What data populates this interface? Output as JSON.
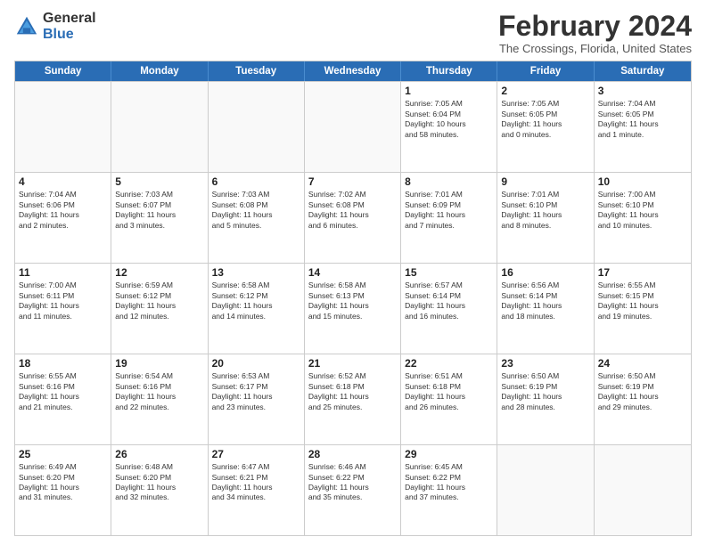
{
  "logo": {
    "general": "General",
    "blue": "Blue"
  },
  "header": {
    "title": "February 2024",
    "subtitle": "The Crossings, Florida, United States"
  },
  "weekdays": [
    "Sunday",
    "Monday",
    "Tuesday",
    "Wednesday",
    "Thursday",
    "Friday",
    "Saturday"
  ],
  "rows": [
    [
      {
        "day": "",
        "info": ""
      },
      {
        "day": "",
        "info": ""
      },
      {
        "day": "",
        "info": ""
      },
      {
        "day": "",
        "info": ""
      },
      {
        "day": "1",
        "info": "Sunrise: 7:05 AM\nSunset: 6:04 PM\nDaylight: 10 hours\nand 58 minutes."
      },
      {
        "day": "2",
        "info": "Sunrise: 7:05 AM\nSunset: 6:05 PM\nDaylight: 11 hours\nand 0 minutes."
      },
      {
        "day": "3",
        "info": "Sunrise: 7:04 AM\nSunset: 6:05 PM\nDaylight: 11 hours\nand 1 minute."
      }
    ],
    [
      {
        "day": "4",
        "info": "Sunrise: 7:04 AM\nSunset: 6:06 PM\nDaylight: 11 hours\nand 2 minutes."
      },
      {
        "day": "5",
        "info": "Sunrise: 7:03 AM\nSunset: 6:07 PM\nDaylight: 11 hours\nand 3 minutes."
      },
      {
        "day": "6",
        "info": "Sunrise: 7:03 AM\nSunset: 6:08 PM\nDaylight: 11 hours\nand 5 minutes."
      },
      {
        "day": "7",
        "info": "Sunrise: 7:02 AM\nSunset: 6:08 PM\nDaylight: 11 hours\nand 6 minutes."
      },
      {
        "day": "8",
        "info": "Sunrise: 7:01 AM\nSunset: 6:09 PM\nDaylight: 11 hours\nand 7 minutes."
      },
      {
        "day": "9",
        "info": "Sunrise: 7:01 AM\nSunset: 6:10 PM\nDaylight: 11 hours\nand 8 minutes."
      },
      {
        "day": "10",
        "info": "Sunrise: 7:00 AM\nSunset: 6:10 PM\nDaylight: 11 hours\nand 10 minutes."
      }
    ],
    [
      {
        "day": "11",
        "info": "Sunrise: 7:00 AM\nSunset: 6:11 PM\nDaylight: 11 hours\nand 11 minutes."
      },
      {
        "day": "12",
        "info": "Sunrise: 6:59 AM\nSunset: 6:12 PM\nDaylight: 11 hours\nand 12 minutes."
      },
      {
        "day": "13",
        "info": "Sunrise: 6:58 AM\nSunset: 6:12 PM\nDaylight: 11 hours\nand 14 minutes."
      },
      {
        "day": "14",
        "info": "Sunrise: 6:58 AM\nSunset: 6:13 PM\nDaylight: 11 hours\nand 15 minutes."
      },
      {
        "day": "15",
        "info": "Sunrise: 6:57 AM\nSunset: 6:14 PM\nDaylight: 11 hours\nand 16 minutes."
      },
      {
        "day": "16",
        "info": "Sunrise: 6:56 AM\nSunset: 6:14 PM\nDaylight: 11 hours\nand 18 minutes."
      },
      {
        "day": "17",
        "info": "Sunrise: 6:55 AM\nSunset: 6:15 PM\nDaylight: 11 hours\nand 19 minutes."
      }
    ],
    [
      {
        "day": "18",
        "info": "Sunrise: 6:55 AM\nSunset: 6:16 PM\nDaylight: 11 hours\nand 21 minutes."
      },
      {
        "day": "19",
        "info": "Sunrise: 6:54 AM\nSunset: 6:16 PM\nDaylight: 11 hours\nand 22 minutes."
      },
      {
        "day": "20",
        "info": "Sunrise: 6:53 AM\nSunset: 6:17 PM\nDaylight: 11 hours\nand 23 minutes."
      },
      {
        "day": "21",
        "info": "Sunrise: 6:52 AM\nSunset: 6:18 PM\nDaylight: 11 hours\nand 25 minutes."
      },
      {
        "day": "22",
        "info": "Sunrise: 6:51 AM\nSunset: 6:18 PM\nDaylight: 11 hours\nand 26 minutes."
      },
      {
        "day": "23",
        "info": "Sunrise: 6:50 AM\nSunset: 6:19 PM\nDaylight: 11 hours\nand 28 minutes."
      },
      {
        "day": "24",
        "info": "Sunrise: 6:50 AM\nSunset: 6:19 PM\nDaylight: 11 hours\nand 29 minutes."
      }
    ],
    [
      {
        "day": "25",
        "info": "Sunrise: 6:49 AM\nSunset: 6:20 PM\nDaylight: 11 hours\nand 31 minutes."
      },
      {
        "day": "26",
        "info": "Sunrise: 6:48 AM\nSunset: 6:20 PM\nDaylight: 11 hours\nand 32 minutes."
      },
      {
        "day": "27",
        "info": "Sunrise: 6:47 AM\nSunset: 6:21 PM\nDaylight: 11 hours\nand 34 minutes."
      },
      {
        "day": "28",
        "info": "Sunrise: 6:46 AM\nSunset: 6:22 PM\nDaylight: 11 hours\nand 35 minutes."
      },
      {
        "day": "29",
        "info": "Sunrise: 6:45 AM\nSunset: 6:22 PM\nDaylight: 11 hours\nand 37 minutes."
      },
      {
        "day": "",
        "info": ""
      },
      {
        "day": "",
        "info": ""
      }
    ]
  ]
}
